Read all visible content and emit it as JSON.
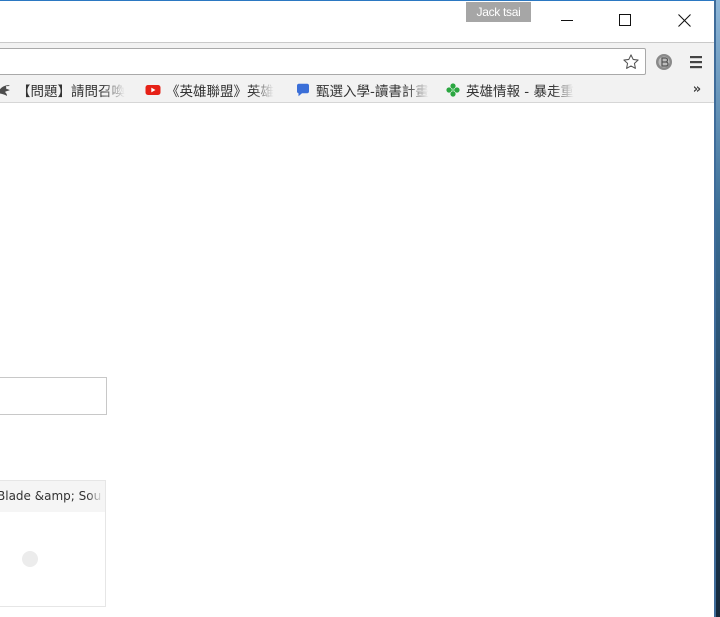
{
  "window": {
    "profile_name": "Jack tsai",
    "controls": [
      "minimize-icon",
      "maximize-icon",
      "close-icon"
    ]
  },
  "toolbar": {
    "address_value": "",
    "icons": [
      "star-icon",
      "extension-icon",
      "menu-icon"
    ]
  },
  "bookmarks": {
    "items": [
      {
        "label": "【問題】請問召喚",
        "icon": "gamer-wing-icon"
      },
      {
        "label": "《英雄聯盟》英雄",
        "icon": "youtube-icon"
      },
      {
        "label": "甄選入學-讀書計畫",
        "icon": "chat-bubble-icon"
      },
      {
        "label": "英雄情報 - 暴走重",
        "icon": "clover-icon"
      }
    ],
    "overflow_label": "»"
  },
  "page": {
    "card_title": "Blade &amp; Sou"
  },
  "colors": {
    "profile_badge": "#a6a6a6",
    "toolbar_bg": "#f2f2f2",
    "window_border": "#2b78c2",
    "youtube_red": "#e62117",
    "chat_blue": "#3b6fd8",
    "clover_green": "#2aa640"
  }
}
